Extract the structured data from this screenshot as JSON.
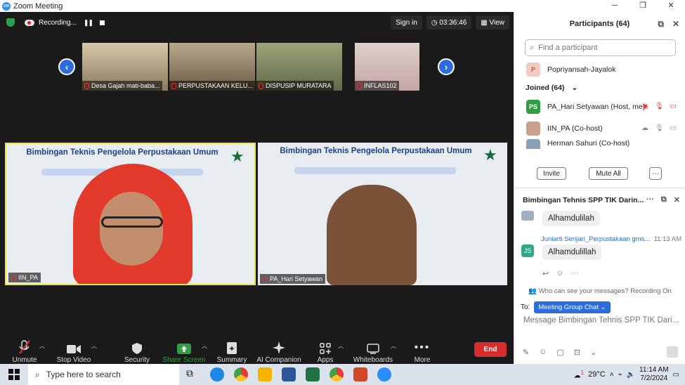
{
  "window": {
    "title": "Zoom Meeting",
    "minimize": "─",
    "restore": "❐",
    "close": "✕"
  },
  "topbar": {
    "recording": "Recording...",
    "signin": "Sign in",
    "timer": "03:36:46",
    "view": "View"
  },
  "strip": [
    {
      "name": "Desa Gajah mati-baba..."
    },
    {
      "name": "PERPUSTAKAAN KELU..."
    },
    {
      "name": "DISPUSIP MURATARA"
    },
    {
      "name": "INFLAS102"
    }
  ],
  "tiles": [
    {
      "name": "IIN_PA",
      "slide_title": "Bimbingan Teknis Pengelola Perpustakaan Umum"
    },
    {
      "name": "PA_Hari Setyawan",
      "slide_title": "Bimbingan Teknis Pengelola Perpustakaan Umum"
    }
  ],
  "toolbar": {
    "unmute": "Unmute",
    "stop_video": "Stop Video",
    "security": "Security",
    "share": "Share Screen",
    "summary": "Summary",
    "ai": "AI Companion",
    "apps": "Apps",
    "whiteboards": "Whiteboards",
    "more": "More",
    "end": "End"
  },
  "participants": {
    "header": "Participants (64)",
    "search_placeholder": "Find a participant",
    "waiting": [
      {
        "initial": "P",
        "name": "Popriyansah-Jayalok"
      }
    ],
    "joined_label": "Joined (64)",
    "joined": [
      {
        "initials": "PS",
        "name": "PA_Hari Setyawan (Host, me)"
      },
      {
        "initials": "",
        "name": "IIN_PA (Co-host)"
      },
      {
        "initials": "",
        "name": "Herman Sahuri (Co-host)"
      }
    ],
    "invite": "Invite",
    "mute_all": "Mute All",
    "more": "···"
  },
  "chat": {
    "header": "Bimbingan Tehnis SPP TIK Darin...",
    "messages": [
      {
        "text": "Alhamdulilah"
      },
      {
        "sender": "Juniarti Senjari_Perpustakaan gms...",
        "time": "11:13 AM",
        "initials": "JS",
        "text": "Alhamdulillah"
      }
    ],
    "visibility": "Who can see your messages? Recording On",
    "to_label": "To:",
    "to_value": "Meeting Group Chat",
    "input_placeholder": "Message Bimbingan Tehnis SPP TIK Dari..."
  },
  "taskbar": {
    "search": "Type here to search",
    "weather": "29°C",
    "time": "11:14 AM",
    "date": "7/2/2024",
    "badge": "1"
  },
  "colors": {
    "accent": "#2d6cdf",
    "end": "#d62c2c",
    "share": "#2ea043",
    "active_border": "#e7e44e"
  }
}
